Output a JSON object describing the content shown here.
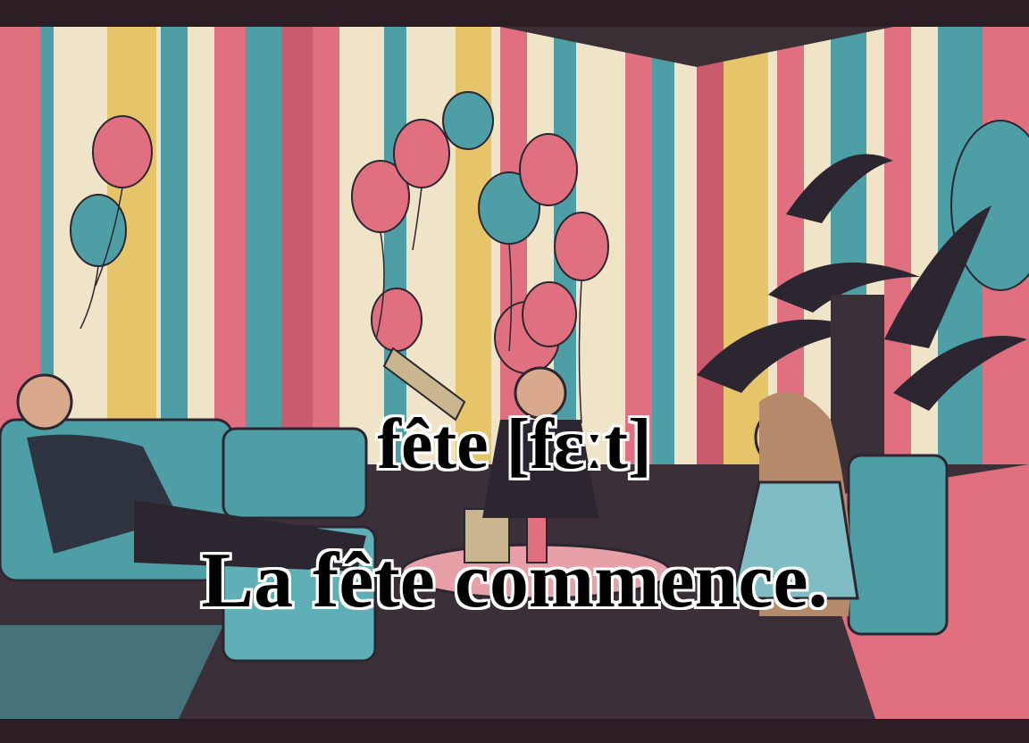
{
  "caption": {
    "word": "fête [fɛːt]",
    "sentence": "La fête commence."
  },
  "illustration": {
    "subject": "party-scene",
    "palette": {
      "frame": "#2a1e24",
      "pink": "#e0707f",
      "teal": "#4e9ea6",
      "cream": "#f0e4c8",
      "yellow": "#e6c46a",
      "dark": "#2b2630"
    }
  }
}
